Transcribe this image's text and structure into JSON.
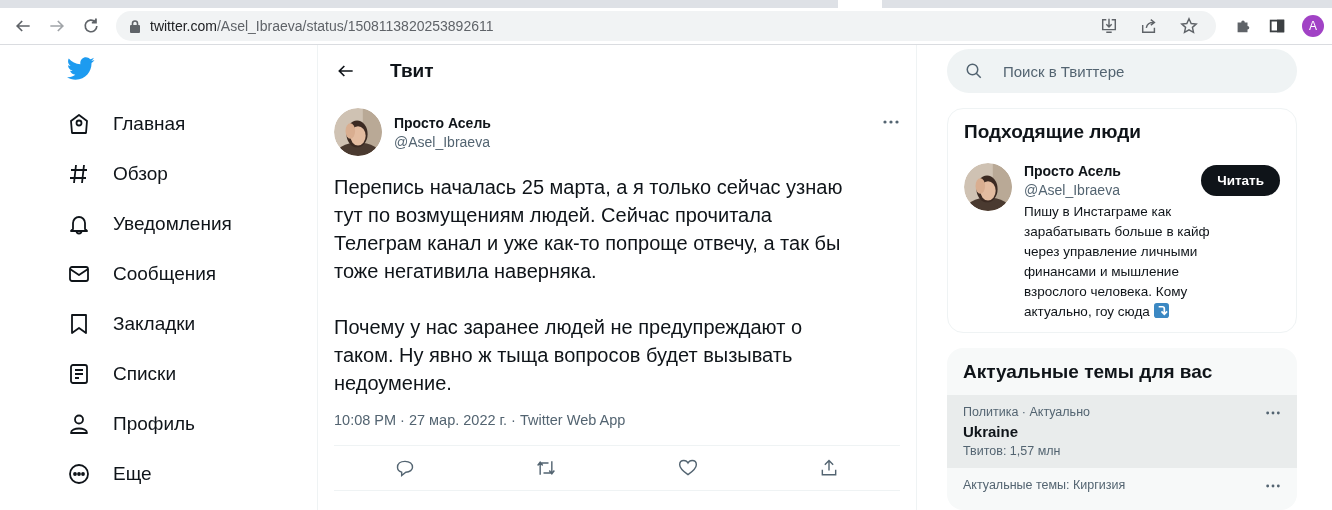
{
  "browser": {
    "nav": [
      {
        "kind": "back",
        "disabled": false
      },
      {
        "kind": "forward",
        "disabled": true
      },
      {
        "kind": "reload",
        "disabled": false
      }
    ],
    "url": {
      "host": "twitter.com",
      "path": "/Asel_Ibraeva/status/1508113820253892611"
    },
    "profile_initial": "A"
  },
  "sidebar": {
    "items": [
      {
        "label": "Главная"
      },
      {
        "label": "Обзор"
      },
      {
        "label": "Уведомления"
      },
      {
        "label": "Сообщения"
      },
      {
        "label": "Закладки"
      },
      {
        "label": "Списки"
      },
      {
        "label": "Профиль"
      },
      {
        "label": "Еще"
      }
    ]
  },
  "header": {
    "title": "Твит"
  },
  "tweet": {
    "name": "Просто Асель",
    "handle": "@Asel_Ibraeva",
    "paragraphs": [
      "Перепись началась 25 марта, а я только сейчас узнаю тут по возмущениям людей. Сейчас прочитала Телеграм канал и уже как-то попроще отвечу, а так бы тоже негативила наверняка.",
      "Почему у нас заранее людей не предупреждают о таком. Ну явно ж тыща вопросов будет вызывать недоумение."
    ],
    "meta": "10:08 PM · 27 мар. 2022 г. · Twitter Web App"
  },
  "search": {
    "placeholder": "Поиск в Твиттере"
  },
  "who_to_follow": {
    "title": "Подходящие люди",
    "users": [
      {
        "name": "Просто Асель",
        "handle": "@Asel_Ibraeva",
        "button": "Читать",
        "bio": "Пишу в Инстаграме как зарабатывать больше в кайф через управление личными финансами и мышление взрослого человека. Кому актуально, гоу сюда"
      }
    ]
  },
  "trends": {
    "title": "Актуальные темы для вас",
    "items": [
      {
        "category": "Политика · Актуально",
        "name": "Ukraine",
        "count": "Твитов: 1,57 млн",
        "selected": true
      },
      {
        "category": "Актуальные темы: Киргизия",
        "selected": false
      }
    ]
  }
}
